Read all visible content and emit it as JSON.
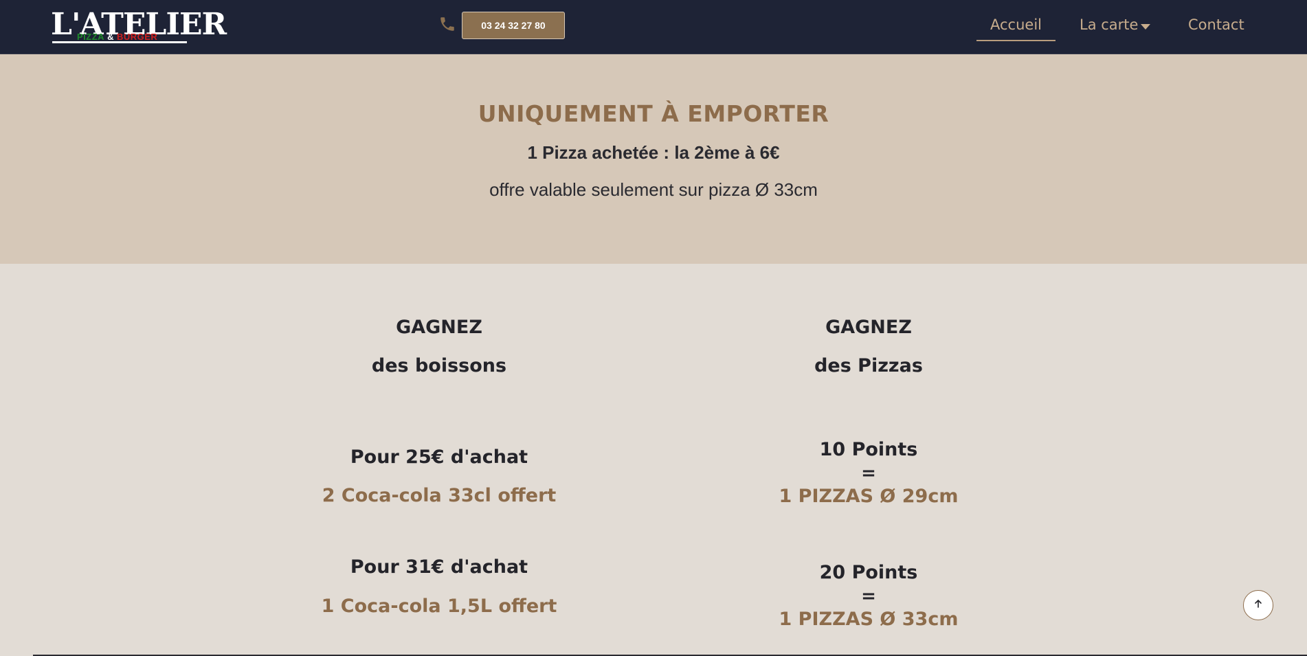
{
  "header": {
    "logo": {
      "main": "L'ATELIER",
      "sub_pizza": "PIZZA",
      "sub_amp": "&",
      "sub_burger": "BURGER"
    },
    "phone_icon": "phone-icon",
    "phone_number": "03 24 32 27 80",
    "nav": {
      "home": "Accueil",
      "carte": "La carte",
      "contact": "Contact"
    },
    "colors": {
      "background": "#1e2336",
      "accent": "#c8ad8d",
      "button": "#8b7050"
    }
  },
  "promo": {
    "title": "UNIQUEMENT À EMPORTER",
    "offer": "1 Pizza achetée : la 2ème à 6€",
    "note": "offre valable seulement sur pizza Ø 33cm"
  },
  "rewards": {
    "drinks": {
      "heading": "GAGNEZ",
      "subheading": "des boissons",
      "tiers": [
        {
          "condition": "Pour 25€ d'achat",
          "reward": "2 Coca-cola 33cl offert"
        },
        {
          "condition": "Pour 31€ d'achat",
          "reward": "1 Coca-cola 1,5L offert"
        }
      ]
    },
    "pizzas": {
      "heading": "GAGNEZ",
      "subheading": "des Pizzas",
      "tiers": [
        {
          "points": "10 Points",
          "equals": "=",
          "reward": "1 PIZZAS Ø 29cm"
        },
        {
          "points": "20 Points",
          "equals": "=",
          "reward": "1 PIZZAS Ø 33cm"
        }
      ]
    }
  },
  "scroll_top_icon": "arrow-up-icon"
}
